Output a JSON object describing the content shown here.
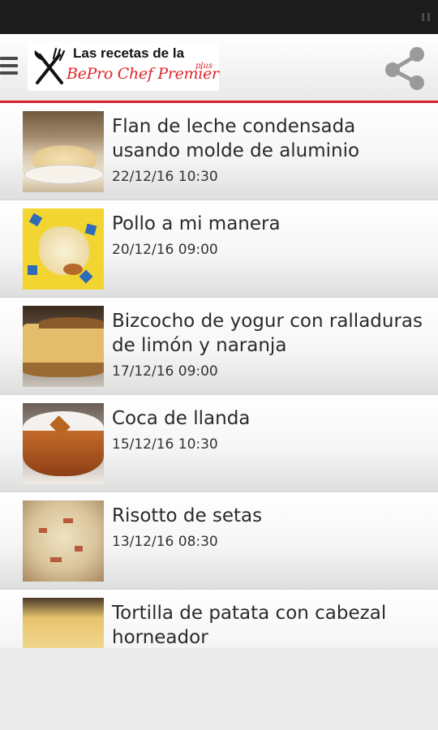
{
  "header": {
    "logo_line1": "Las recetas de la",
    "logo_line2": "BePro Chef Premier",
    "logo_plus": "plus"
  },
  "colors": {
    "accent": "#d9232b",
    "status_bar": "#1c1c1c"
  },
  "icons": {
    "menu": "hamburger-icon",
    "share": "share-icon",
    "logo": "fork-knife-icon"
  },
  "recipes": [
    {
      "title": "Flan de leche condensada usando molde de aluminio",
      "date": "22/12/16 10:30"
    },
    {
      "title": "Pollo a mi manera",
      "date": "20/12/16 09:00"
    },
    {
      "title": "Bizcocho de yogur con ralladuras de limón y naranja",
      "date": "17/12/16 09:00"
    },
    {
      "title": "Coca de llanda",
      "date": "15/12/16 10:30"
    },
    {
      "title": "Risotto de setas",
      "date": "13/12/16 08:30"
    },
    {
      "title": "Tortilla de patata con cabezal horneador",
      "date": ""
    }
  ]
}
